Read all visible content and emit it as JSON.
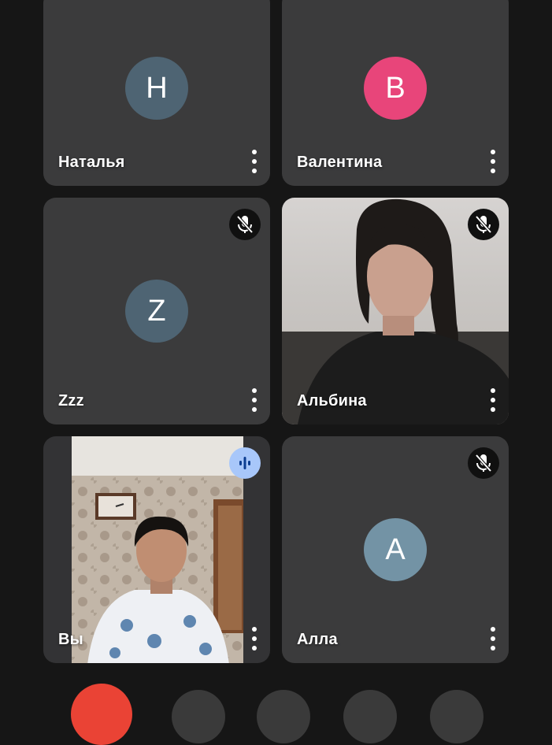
{
  "participants": [
    {
      "name": "Наталья",
      "initial": "Н",
      "avatar_color": "#4e6473",
      "muted": false,
      "speaking": false,
      "video": false
    },
    {
      "name": "Валентина",
      "initial": "В",
      "avatar_color": "#e8457a",
      "muted": false,
      "speaking": false,
      "video": false
    },
    {
      "name": "Zzz",
      "initial": "Z",
      "avatar_color": "#4e6473",
      "muted": true,
      "speaking": false,
      "video": false
    },
    {
      "name": "Альбина",
      "initial": "",
      "avatar_color": "",
      "muted": true,
      "speaking": false,
      "video": true
    },
    {
      "name": "Вы",
      "initial": "",
      "avatar_color": "",
      "muted": false,
      "speaking": true,
      "video": true
    },
    {
      "name": "Алла",
      "initial": "А",
      "avatar_color": "#7393a5",
      "muted": true,
      "speaking": false,
      "video": false
    }
  ],
  "icons": {
    "more": "more-vert-icon",
    "mic_off": "mic-off-icon",
    "speaking": "audio-level-icon",
    "end_call": "end-call-icon"
  },
  "colors": {
    "background": "#161616",
    "tile": "#3b3b3c",
    "end_call": "#ea4335",
    "speaking_badge": "#a8c7fa"
  }
}
